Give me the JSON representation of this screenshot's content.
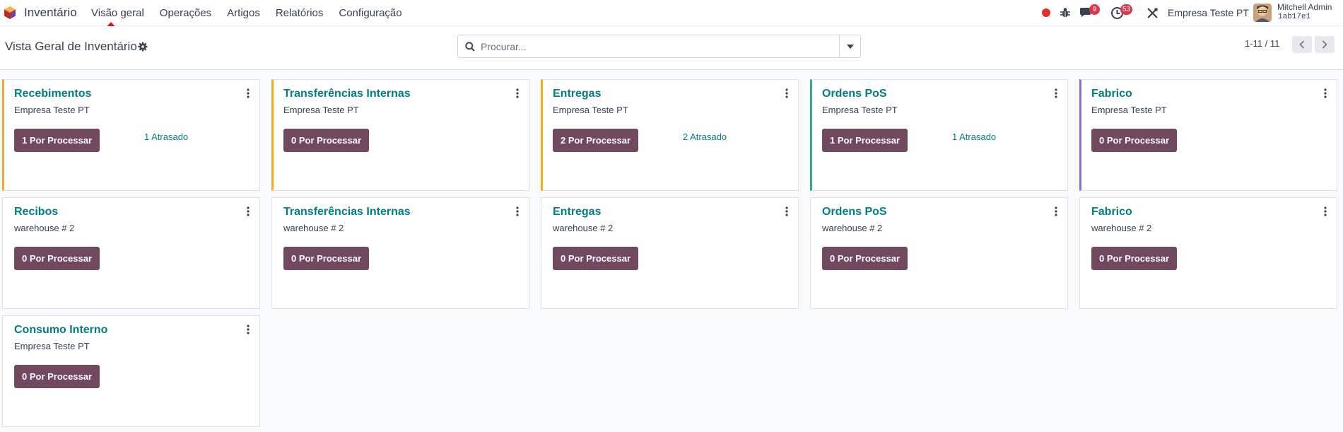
{
  "navbar": {
    "app_name": "Inventário",
    "menu": [
      "Visão geral",
      "Operações",
      "Artigos",
      "Relatórios",
      "Configuração"
    ],
    "chat_count": "9",
    "activity_count": "53",
    "company": "Empresa Teste PT",
    "user_name": "Mitchell Admin",
    "db_name": "1ab17e1"
  },
  "control_panel": {
    "title": "Vista Geral de Inventário",
    "search_placeholder": "Procurar...",
    "pager": "1-11 / 11"
  },
  "colors": {
    "accent_yellow": "#f0ad1d",
    "accent_teal": "#3aa596",
    "accent_purple": "#8a6ed8",
    "button": "#71495f",
    "link": "#017e84"
  },
  "cards": [
    {
      "title": "Recebimentos",
      "subtitle": "Empresa Teste PT",
      "button": "1 Por Processar",
      "late": "1 Atrasado",
      "accent": "yellow"
    },
    {
      "title": "Transferências Internas",
      "subtitle": "Empresa Teste PT",
      "button": "0 Por Processar",
      "late": "",
      "accent": "yellow"
    },
    {
      "title": "Entregas",
      "subtitle": "Empresa Teste PT",
      "button": "2 Por Processar",
      "late": "2 Atrasado",
      "accent": "yellow"
    },
    {
      "title": "Ordens PoS",
      "subtitle": "Empresa Teste PT",
      "button": "1 Por Processar",
      "late": "1 Atrasado",
      "accent": "teal"
    },
    {
      "title": "Fabrico",
      "subtitle": "Empresa Teste PT",
      "button": "0 Por Processar",
      "late": "",
      "accent": "purple"
    },
    {
      "title": "Recibos",
      "subtitle": "warehouse # 2",
      "button": "0 Por Processar",
      "late": "",
      "accent": ""
    },
    {
      "title": "Transferências Internas",
      "subtitle": "warehouse # 2",
      "button": "0 Por Processar",
      "late": "",
      "accent": ""
    },
    {
      "title": "Entregas",
      "subtitle": "warehouse # 2",
      "button": "0 Por Processar",
      "late": "",
      "accent": ""
    },
    {
      "title": "Ordens PoS",
      "subtitle": "warehouse # 2",
      "button": "0 Por Processar",
      "late": "",
      "accent": ""
    },
    {
      "title": "Fabrico",
      "subtitle": "warehouse # 2",
      "button": "0 Por Processar",
      "late": "",
      "accent": ""
    },
    {
      "title": "Consumo Interno",
      "subtitle": "Empresa Teste PT",
      "button": "0 Por Processar",
      "late": "",
      "accent": ""
    }
  ]
}
